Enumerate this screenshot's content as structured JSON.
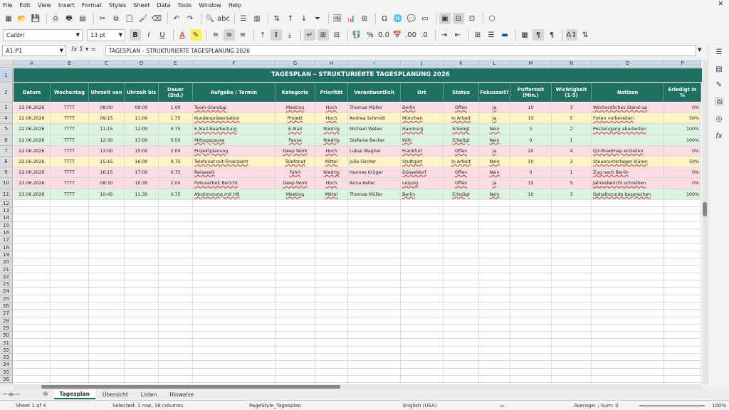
{
  "menu": [
    "File",
    "Edit",
    "View",
    "Insert",
    "Format",
    "Styles",
    "Sheet",
    "Data",
    "Tools",
    "Window",
    "Help"
  ],
  "toolbar": {
    "font_name": "Calibri",
    "font_size": "13 pt"
  },
  "formula_bar": {
    "name_box": "A1:P1",
    "content": "TAGESPLAN – STRUKTURIERTE TAGESPLANUNG 2026"
  },
  "columns": [
    "A",
    "B",
    "C",
    "D",
    "E",
    "F",
    "G",
    "H",
    "I",
    "J",
    "K",
    "L",
    "M",
    "N",
    "O",
    "P"
  ],
  "title": "TAGESPLAN – STRUKTURIERTE TAGESPLANUNG 2026",
  "headers": [
    "Datum",
    "Wochentag",
    "Uhrzeit von",
    "Uhrzeit bis",
    "Dauer (Std.)",
    "Aufgabe / Termin",
    "Kategorie",
    "Priorität",
    "Verantwortlich",
    "Ort",
    "Status",
    "Fokuszeit?",
    "Pufferzeit (Min.)",
    "Wichtigkeit (1-5)",
    "Notizen",
    "Erledigt in %"
  ],
  "rows": [
    [
      "22.06.2026",
      "TTTT",
      "08:00",
      "09:00",
      "1.00",
      "Team-Standup",
      "Meeting",
      "Hoch",
      "Thomas Müller",
      "Berlin",
      "Offen",
      "Ja",
      "10",
      "3",
      "Wöchentliches Stand-up",
      "0%"
    ],
    [
      "22.06.2026",
      "TTTT",
      "09:15",
      "11:00",
      "1.75",
      "Kundenpräsentation",
      "Projekt",
      "Hoch",
      "Andrea Schmidt",
      "München",
      "In Arbeit",
      "Ja",
      "15",
      "5",
      "Folien vorbereiten",
      "50%"
    ],
    [
      "22.06.2026",
      "TTTT",
      "11:15",
      "12:00",
      "0.75",
      "E-Mail-Bearbeitung",
      "E-Mail",
      "Niedrig",
      "Michael Weber",
      "Hamburg",
      "Erledigt",
      "Nein",
      "5",
      "2",
      "Posteingang abarbeiten",
      "100%"
    ],
    [
      "22.06.2026",
      "TTTT",
      "12:30",
      "13:00",
      "0.50",
      "Mittagspause",
      "Pause",
      "Niedrig",
      "Stefanie Becker",
      "Köln",
      "Erledigt",
      "Nein",
      "0",
      "1",
      "",
      "100%"
    ],
    [
      "22.06.2026",
      "TTTT",
      "13:00",
      "15:00",
      "2.00",
      "Projektplanung",
      "Deep Work",
      "Hoch",
      "Lukas Wagner",
      "Frankfurt",
      "Offen",
      "Ja",
      "20",
      "4",
      "Q3-Roadmap erstellen",
      "0%"
    ],
    [
      "22.06.2026",
      "TTTT",
      "15:15",
      "16:00",
      "0.75",
      "Telefonat mit Finanzamt",
      "Telefonat",
      "Mittel",
      "Julia Fischer",
      "Stuttgart",
      "In Arbeit",
      "Nein",
      "10",
      "3",
      "Steuerunterlagen klären",
      "50%"
    ],
    [
      "22.06.2026",
      "TTTT",
      "16:15",
      "17:00",
      "0.75",
      "Reisezeit",
      "Fahrt",
      "Niedrig",
      "Hannes Krüger",
      "Düsseldorf",
      "Offen",
      "Nein",
      "0",
      "1",
      "Zug nach Berlin",
      "0%"
    ],
    [
      "23.06.2026",
      "TTTT",
      "08:30",
      "10:30",
      "2.00",
      "Fokusarbeit Bericht",
      "Deep Work",
      "Hoch",
      "Anna Keller",
      "Leipzig",
      "Offen",
      "Ja",
      "15",
      "5",
      "Jahresbericht schreiben",
      "0%"
    ],
    [
      "23.06.2026",
      "TTTT",
      "10:45",
      "11:30",
      "0.75",
      "Abstimmung mit HR",
      "Meeting",
      "Mittel",
      "Thomas Müller",
      "Berlin",
      "Erledigt",
      "Nein",
      "10",
      "3",
      "Gehaltsrunde besprechen",
      "100%"
    ]
  ],
  "row_colors": {
    "Offen": "#f9dde0",
    "In Arbeit": "#fdf3c4",
    "Erledigt": "#dcf3df"
  },
  "tabs": [
    "Tagesplan",
    "Übersicht",
    "Listen",
    "Hinweise"
  ],
  "status": {
    "sheet": "Sheet 1 of 4",
    "selection": "Selected: 1 row, 16 columns",
    "page_style": "PageStyle_Tagesplan",
    "language": "English (USA)",
    "summary": "Average: ; Sum: 0",
    "zoom": "100%"
  }
}
